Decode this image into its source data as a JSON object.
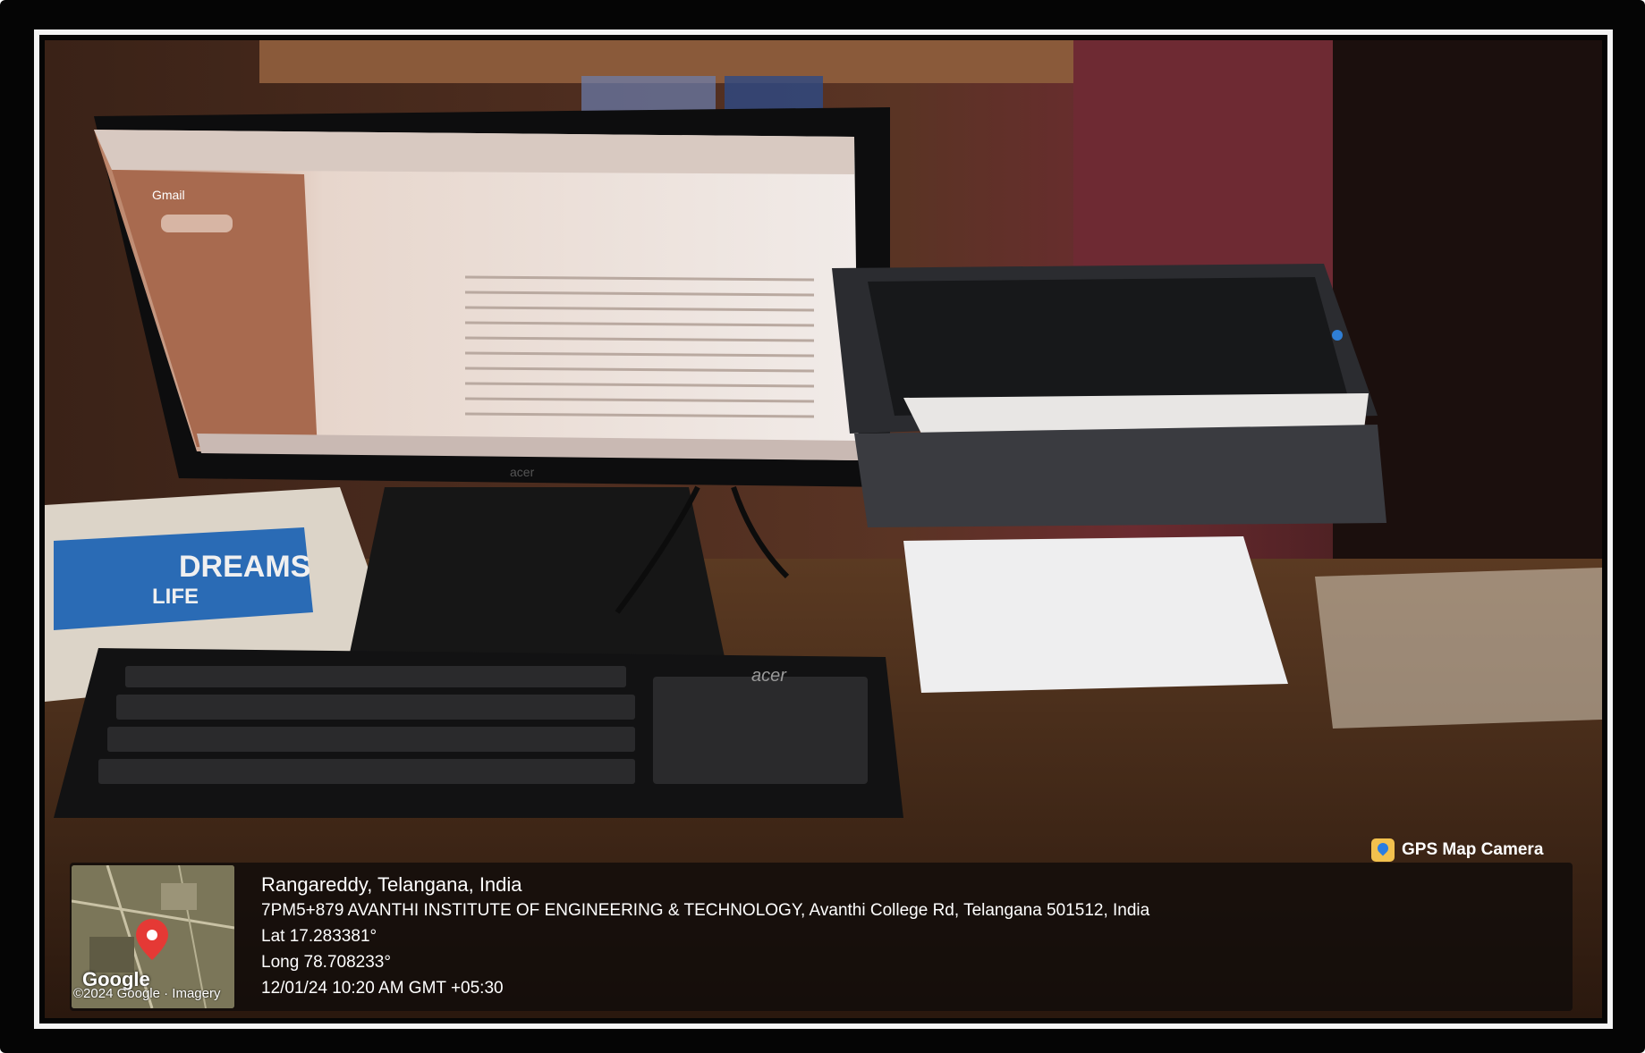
{
  "scene": {
    "monitor_app": "Gmail",
    "monitor_brand": "acer",
    "keyboard_brand": "acer",
    "book_text": "DREAMS LIFE"
  },
  "gps_overlay": {
    "badge_label": "GPS Map Camera",
    "place": "Rangareddy, Telangana, India",
    "address": "7PM5+879 AVANTHI INSTITUTE OF ENGINEERING & TECHNOLOGY, Avanthi College Rd, Telangana 501512, India",
    "latitude": "Lat 17.283381°",
    "longitude": "Long 78.708233°",
    "datetime": "12/01/24 10:20 AM GMT +05:30",
    "map_brand": "Google",
    "map_copyright": "©2024 Google · Imagery"
  },
  "colors": {
    "frame": "#050505",
    "border": "#f4f4f4",
    "overlay_text": "#ffffff",
    "map_pin": "#e53935"
  },
  "icons": [
    "gps-map-camera-icon",
    "map-pin-icon"
  ]
}
